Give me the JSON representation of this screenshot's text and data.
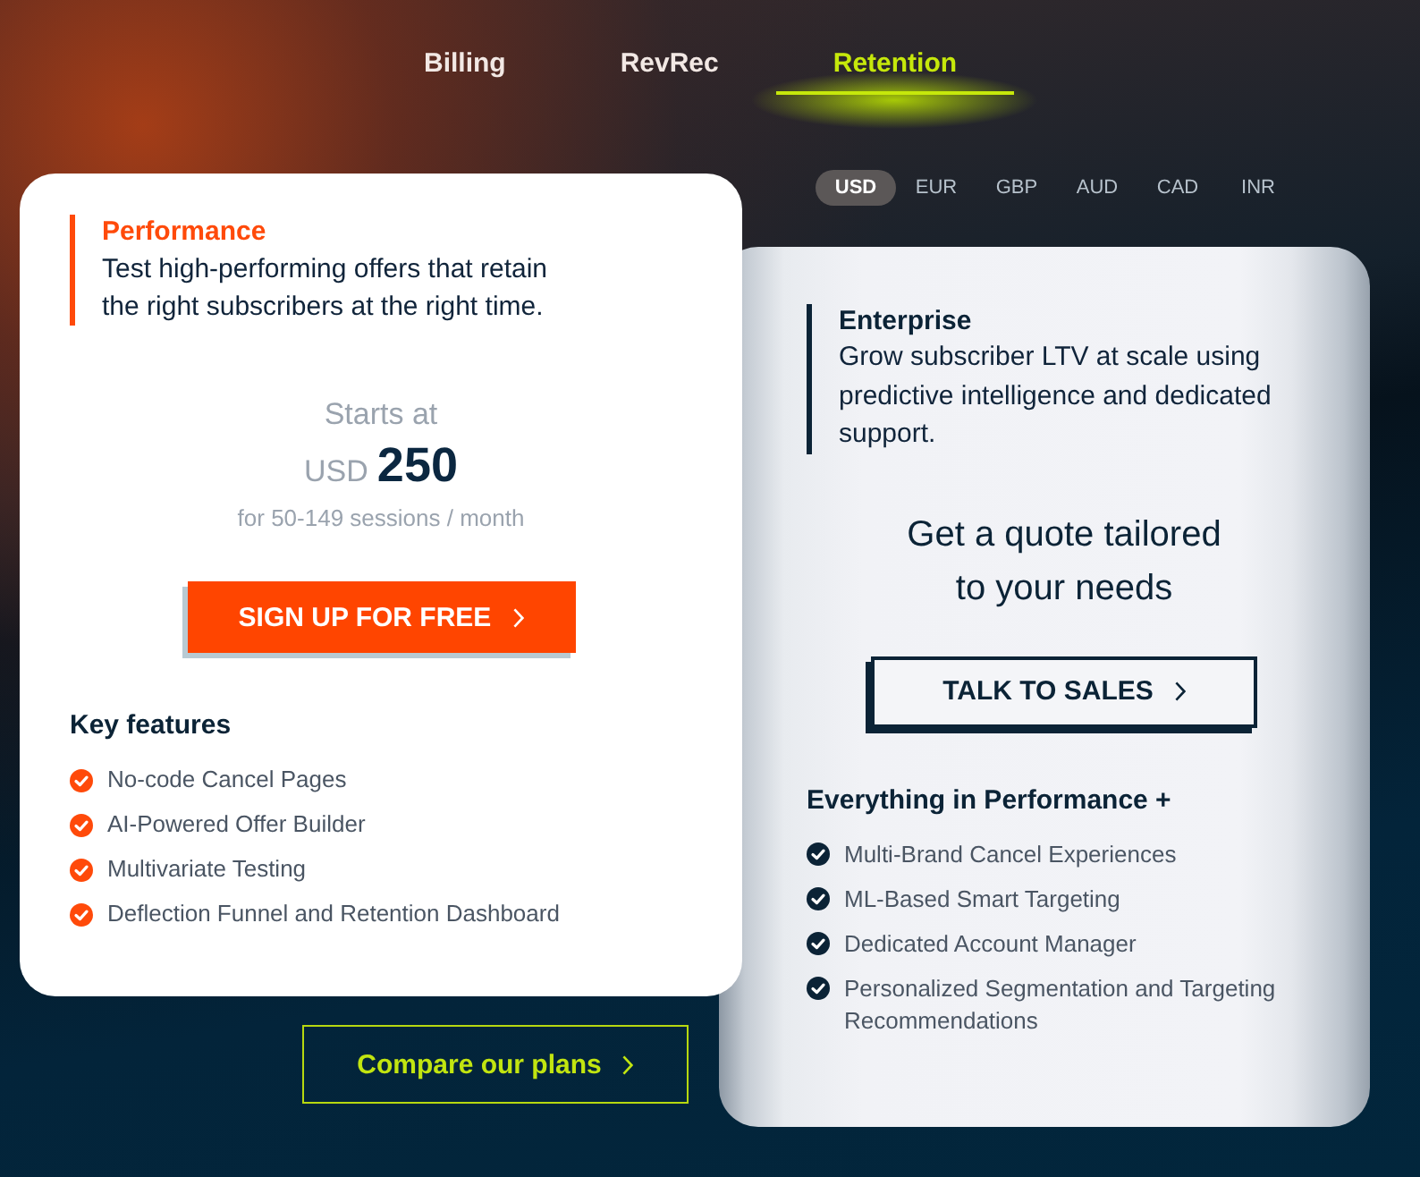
{
  "tabs": [
    {
      "label": "Billing",
      "selected": false
    },
    {
      "label": "RevRec",
      "selected": false
    },
    {
      "label": "Retention",
      "selected": true
    }
  ],
  "currencies": [
    {
      "label": "USD",
      "selected": true
    },
    {
      "label": "EUR",
      "selected": false
    },
    {
      "label": "GBP",
      "selected": false
    },
    {
      "label": "AUD",
      "selected": false
    },
    {
      "label": "CAD",
      "selected": false
    },
    {
      "label": "INR",
      "selected": false
    }
  ],
  "plans": [
    {
      "kind": "performance",
      "title": "Performance",
      "description": "Test high-performing offers that retain the right subscribers at the right time.",
      "price": {
        "intro": "Starts at",
        "currency": "USD",
        "amount": "250",
        "note": "for 50-149 sessions / month"
      },
      "button": {
        "label": "SIGN UP FOR FREE"
      },
      "features_title": "Key features",
      "features": [
        "No-code Cancel Pages",
        "AI-Powered Offer Builder",
        "Multivariate Testing",
        "Deflection Funnel and Retention Dashboard"
      ]
    },
    {
      "kind": "enterprise",
      "title": "Enterprise",
      "description": "Grow subscriber LTV at scale using predictive intelligence and dedicated support.",
      "quote": "Get a quote tailored to your needs",
      "button": {
        "label": "TALK TO SALES"
      },
      "features_title": "Everything in Performance +",
      "features": [
        "Multi-Brand Cancel Experiences",
        "ML-Based Smart Targeting",
        "Dedicated Account Manager",
        "Personalized Segmentation and Targeting Recommendations"
      ]
    }
  ],
  "compare_link": {
    "label": "Compare our plans"
  }
}
